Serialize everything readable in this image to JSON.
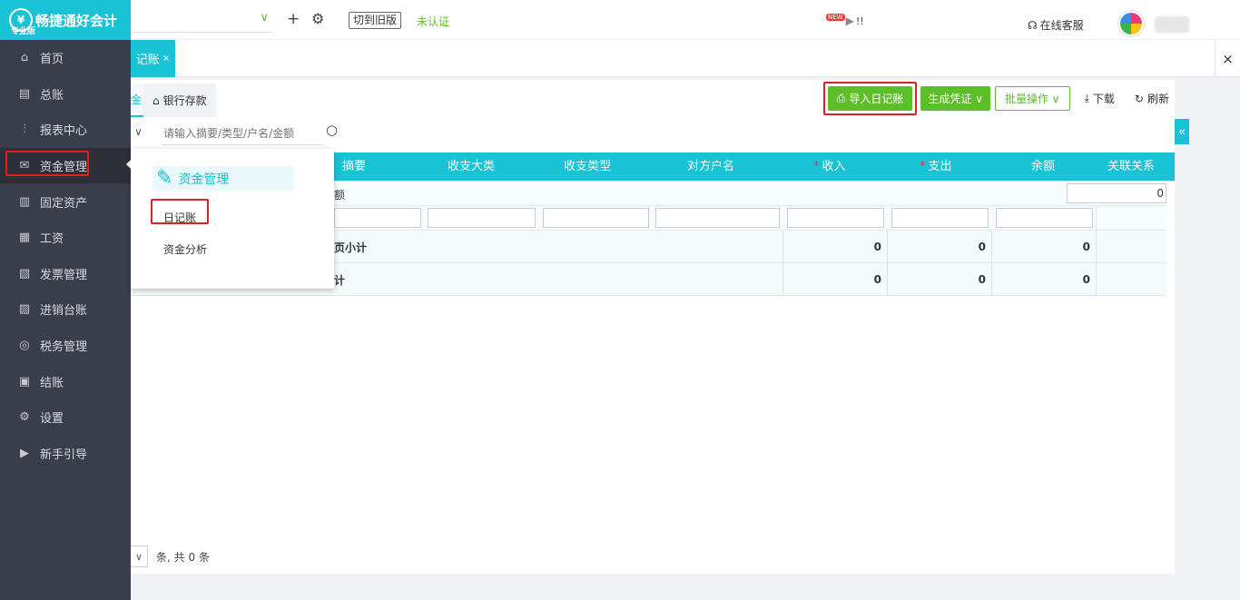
{
  "app": {
    "brand": "畅捷通好会计",
    "edition": "专业版",
    "logo_mark": "¥"
  },
  "sidebar": {
    "items": [
      {
        "label": "首页",
        "icon": "⌂"
      },
      {
        "label": "总账",
        "icon": "▤"
      },
      {
        "label": "报表中心",
        "icon": "⫶"
      },
      {
        "label": "资金管理",
        "icon": "✉"
      },
      {
        "label": "固定资产",
        "icon": "▥"
      },
      {
        "label": "工资",
        "icon": "▦"
      },
      {
        "label": "发票管理",
        "icon": "▧"
      },
      {
        "label": "进销台账",
        "icon": "▨"
      },
      {
        "label": "税务管理",
        "icon": "◎"
      },
      {
        "label": "结账",
        "icon": "▣"
      },
      {
        "label": "设置",
        "icon": "⚙"
      },
      {
        "label": "新手引导",
        "icon": "▶"
      }
    ]
  },
  "topbar": {
    "company_chevron": "∨",
    "plus": "+",
    "gear": "⚙",
    "switch_label": "切到旧版",
    "unverified": "未认证",
    "new_badge": "NEW",
    "video_icon": "▶",
    "exclaim": "!!",
    "service_icon": "☊",
    "service_label": "在线客服"
  },
  "tabs": {
    "active_tab": "记账",
    "active_tab_close": "×",
    "close_all": "×"
  },
  "content": {
    "subtab_active": "金",
    "subtab_bank_icon": "⌂",
    "subtab_bank": "银行存款",
    "toolbar": {
      "import_icon": "⎙",
      "import_label": "导入日记账",
      "generate_label": "生成凭证 ∨",
      "batch_label": "批量操作 ∨",
      "download_icon": "⤓",
      "download_label": "下载",
      "refresh_icon": "↻",
      "refresh_label": "刷新"
    },
    "filter_chevron": "∨",
    "search_placeholder": "请输入摘要/类型/户名/金额",
    "search_icon": "○",
    "expand_icon": "«",
    "table": {
      "headers": {
        "summary": "摘要",
        "category": "收支大类",
        "type": "收支类型",
        "counterparty": "对方户名",
        "income": "收入",
        "expense": "支出",
        "balance": "余额",
        "relation": "关联关系"
      },
      "required_mark": "*",
      "opening_label": "额",
      "opening_value": "0",
      "subtotal_label": "页小计",
      "subtotal_income": "0",
      "subtotal_expense": "0",
      "subtotal_balance": "0",
      "total_label": "计",
      "total_income": "0",
      "total_expense": "0",
      "total_balance": "0"
    },
    "pager": {
      "select_chevron": "∨",
      "summary": "条, 共 0 条"
    }
  },
  "popup": {
    "icon": "✎",
    "title": "资金管理",
    "items": [
      "日记账",
      "资金分析"
    ]
  }
}
